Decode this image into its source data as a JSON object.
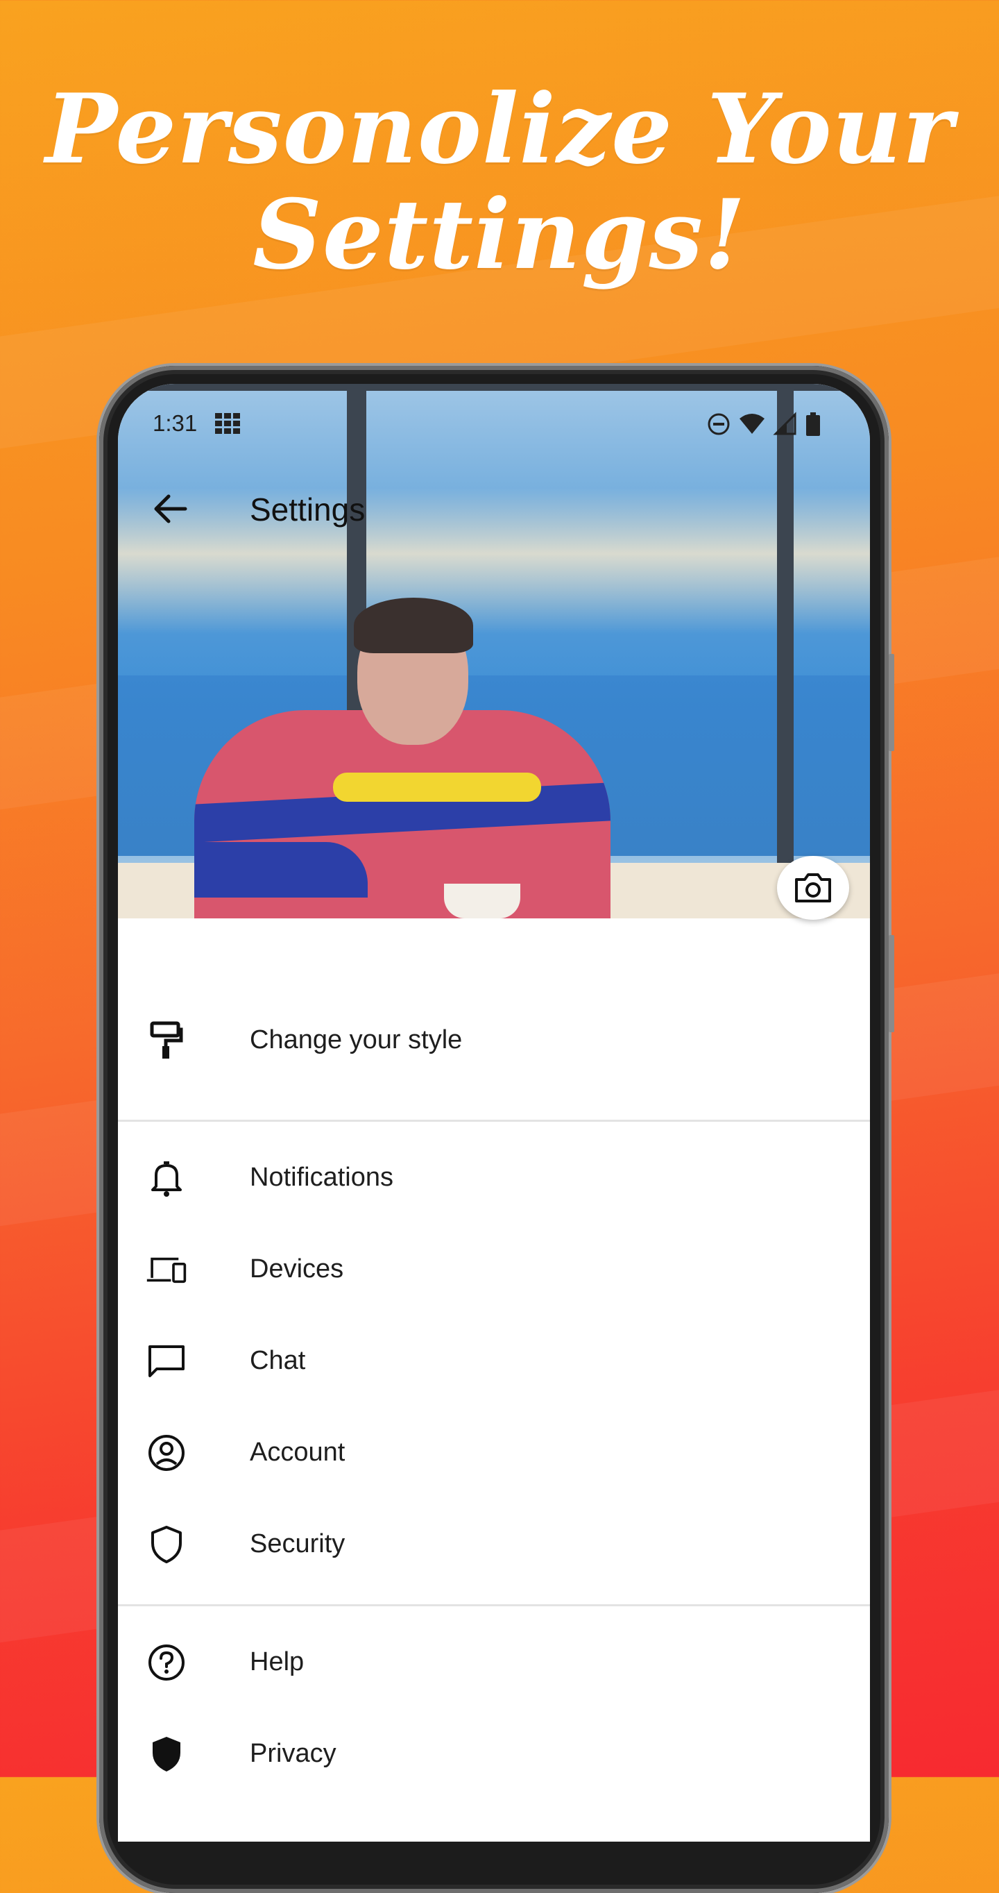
{
  "headline": {
    "line1": "Personolize Your",
    "line2": "Settings!"
  },
  "status_bar": {
    "time": "1:31"
  },
  "app_bar": {
    "title": "Settings"
  },
  "settings": {
    "style": "Change your style",
    "notifications": "Notifications",
    "devices": "Devices",
    "chat": "Chat",
    "account": "Account",
    "security": "Security",
    "help": "Help",
    "privacy": "Privacy"
  },
  "icons": {
    "back": "arrow-left-icon",
    "camera": "camera-icon",
    "style": "paint-roller-icon",
    "notifications": "bell-icon",
    "devices": "devices-icon",
    "chat": "chat-bubble-icon",
    "account": "account-circle-icon",
    "security": "shield-outline-icon",
    "help": "help-circle-icon",
    "privacy": "shield-filled-icon"
  },
  "colors": {
    "accent_top": "#f9a21f",
    "accent_bottom": "#f72a30",
    "text": "#1e1e1e"
  }
}
